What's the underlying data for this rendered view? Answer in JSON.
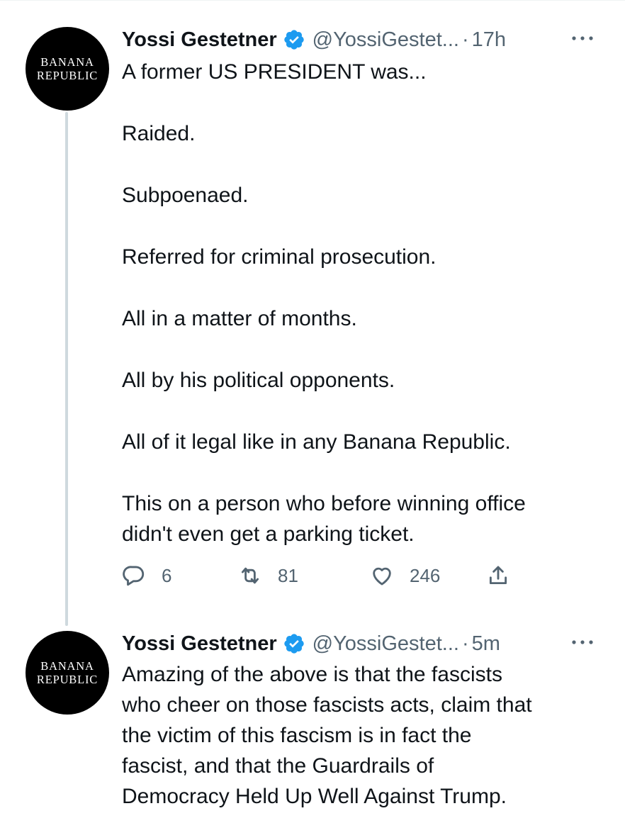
{
  "tweets": [
    {
      "avatar_text": [
        "BANANA",
        "REPUBLIC"
      ],
      "author_name": "Yossi Gestetner",
      "handle": "@YossiGestet...",
      "separator": "·",
      "time": "17h",
      "paragraphs": [
        "A former US PRESIDENT was...",
        "Raided.",
        "Subpoenaed.",
        "Referred for criminal prosecution.",
        "All in a matter of months.",
        "All by his political opponents.",
        "All of it legal like in any Banana Republic.",
        "This on a person who before winning office\ndidn't even get a parking ticket."
      ],
      "actions": {
        "replies": "6",
        "retweets": "81",
        "likes": "246"
      }
    },
    {
      "avatar_text": [
        "BANANA",
        "REPUBLIC"
      ],
      "author_name": "Yossi Gestetner",
      "handle": "@YossiGestet...",
      "separator": "·",
      "time": "5m",
      "paragraphs": [
        "Amazing of the above is that the fascists\nwho cheer on those fascists acts, claim that\nthe victim of this fascism is in fact the\nfascist, and that the Guardrails of\nDemocracy Held Up Well Against Trump."
      ]
    }
  ],
  "icons": {
    "verified": "verified-badge-icon",
    "more": "more-options-icon",
    "reply": "reply-icon",
    "retweet": "retweet-icon",
    "like": "like-icon",
    "share": "share-icon"
  },
  "colors": {
    "verified": "#1d9bf0",
    "muted": "#536471",
    "text": "#0f1419",
    "thread_line": "#cfd9de",
    "avatar_bg": "#000000"
  }
}
